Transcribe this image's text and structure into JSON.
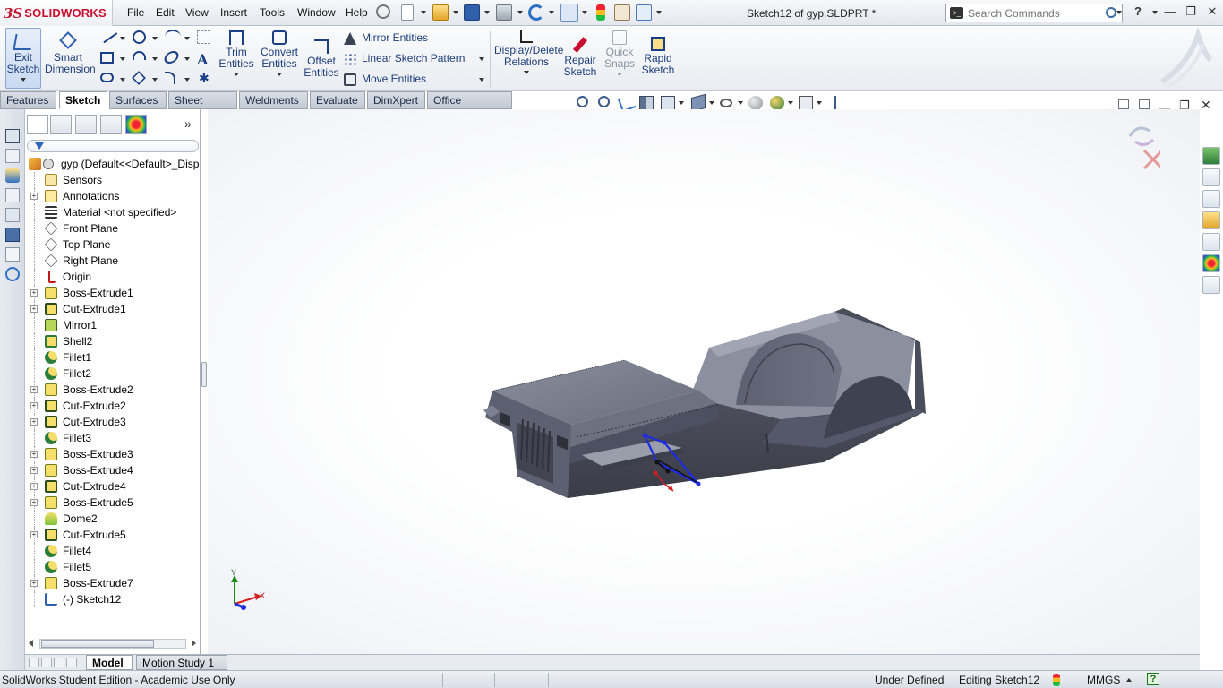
{
  "app": {
    "brand": "SOLIDWORKS",
    "brand_prefix": "3S",
    "document_title": "Sketch12 of gyp.SLDPRT *"
  },
  "menu": [
    "File",
    "Edit",
    "View",
    "Insert",
    "Tools",
    "Window",
    "Help"
  ],
  "search": {
    "placeholder": "Search Commands",
    "value": ""
  },
  "commands": {
    "exit_sketch": "Exit\nSketch",
    "smart_dimension": "Smart\nDimension",
    "trim_entities": "Trim\nEntities",
    "convert_entities": "Convert\nEntities",
    "offset_entities": "Offset\nEntities",
    "mirror_entities": "Mirror Entities",
    "linear_sketch_pattern": "Linear Sketch Pattern",
    "move_entities": "Move Entities",
    "display_delete_relations": "Display/Delete\nRelations",
    "repair_sketch": "Repair\nSketch",
    "quick_snaps": "Quick\nSnaps",
    "rapid_sketch": "Rapid\nSketch"
  },
  "tabs": [
    "Features",
    "Sketch",
    "Surfaces",
    "Sheet Metal",
    "Weldments",
    "Evaluate",
    "DimXpert",
    "Office Products"
  ],
  "active_tab": "Sketch",
  "feature_tree": {
    "root": "gyp  (Default<<Default>_Disp",
    "items": [
      {
        "label": "Sensors",
        "expandable": false,
        "icon": "sensor-icon"
      },
      {
        "label": "Annotations",
        "expandable": true,
        "icon": "annotation-icon"
      },
      {
        "label": "Material <not specified>",
        "expandable": false,
        "icon": "material-icon"
      },
      {
        "label": "Front Plane",
        "expandable": false,
        "icon": "plane-icon"
      },
      {
        "label": "Top Plane",
        "expandable": false,
        "icon": "plane-icon"
      },
      {
        "label": "Right Plane",
        "expandable": false,
        "icon": "plane-icon"
      },
      {
        "label": "Origin",
        "expandable": false,
        "icon": "origin-icon"
      },
      {
        "label": "Boss-Extrude1",
        "expandable": true,
        "icon": "boss-extrude-icon"
      },
      {
        "label": "Cut-Extrude1",
        "expandable": true,
        "icon": "cut-extrude-icon"
      },
      {
        "label": "Mirror1",
        "expandable": false,
        "icon": "mirror-icon"
      },
      {
        "label": "Shell2",
        "expandable": false,
        "icon": "shell-icon"
      },
      {
        "label": "Fillet1",
        "expandable": false,
        "icon": "fillet-icon"
      },
      {
        "label": "Fillet2",
        "expandable": false,
        "icon": "fillet-icon"
      },
      {
        "label": "Boss-Extrude2",
        "expandable": true,
        "icon": "boss-extrude-icon"
      },
      {
        "label": "Cut-Extrude2",
        "expandable": true,
        "icon": "cut-extrude-icon"
      },
      {
        "label": "Cut-Extrude3",
        "expandable": true,
        "icon": "cut-extrude-icon"
      },
      {
        "label": "Fillet3",
        "expandable": false,
        "icon": "fillet-icon"
      },
      {
        "label": "Boss-Extrude3",
        "expandable": true,
        "icon": "boss-extrude-icon"
      },
      {
        "label": "Boss-Extrude4",
        "expandable": true,
        "icon": "boss-extrude-icon"
      },
      {
        "label": "Cut-Extrude4",
        "expandable": true,
        "icon": "cut-extrude-icon"
      },
      {
        "label": "Boss-Extrude5",
        "expandable": true,
        "icon": "boss-extrude-icon"
      },
      {
        "label": "Dome2",
        "expandable": false,
        "icon": "dome-icon"
      },
      {
        "label": "Cut-Extrude5",
        "expandable": true,
        "icon": "cut-extrude-icon"
      },
      {
        "label": "Fillet4",
        "expandable": false,
        "icon": "fillet-icon"
      },
      {
        "label": "Fillet5",
        "expandable": false,
        "icon": "fillet-icon"
      },
      {
        "label": "Boss-Extrude7",
        "expandable": true,
        "icon": "boss-extrude-icon"
      },
      {
        "label": "(-) Sketch12",
        "expandable": false,
        "icon": "sketch-icon"
      }
    ]
  },
  "bottom_tabs": [
    "Model",
    "Motion Study 1"
  ],
  "active_bottom_tab": "Model",
  "triad": {
    "x": "X",
    "y": "Y"
  },
  "status": {
    "edition": "SolidWorks Student Edition - Academic Use Only",
    "sketch_state": "Under Defined",
    "editing": "Editing Sketch12",
    "units": "MMGS",
    "help": "?"
  },
  "colors": {
    "accent": "#1c3d7a",
    "brand": "#c8102e",
    "model_body": "#5a5d6b",
    "sketch_line": "#1e2be0"
  }
}
